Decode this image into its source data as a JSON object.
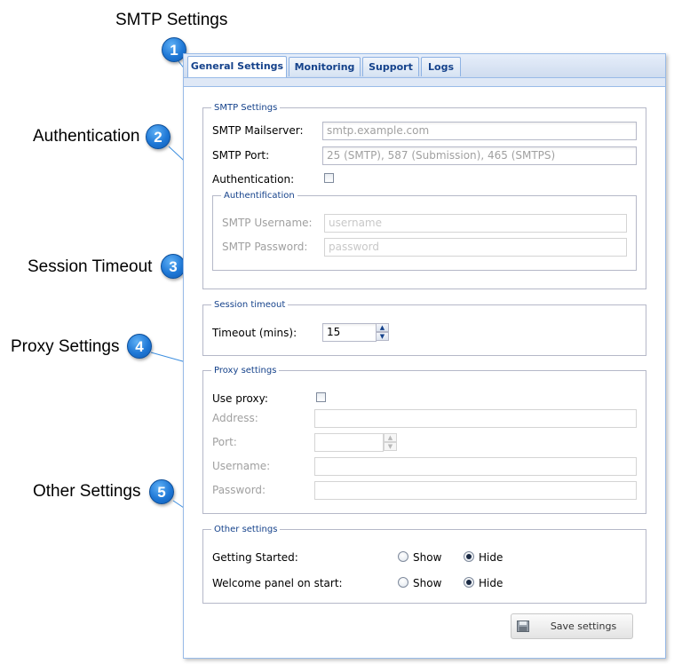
{
  "callouts": [
    {
      "num": "1",
      "label": "SMTP Settings"
    },
    {
      "num": "2",
      "label": "Authentication"
    },
    {
      "num": "3",
      "label": "Session Timeout"
    },
    {
      "num": "4",
      "label": "Proxy Settings"
    },
    {
      "num": "5",
      "label": "Other Settings"
    }
  ],
  "tabs": [
    {
      "label": "General Settings",
      "active": true
    },
    {
      "label": "Monitoring"
    },
    {
      "label": "Support"
    },
    {
      "label": "Logs"
    }
  ],
  "smtp": {
    "legend": "SMTP Settings",
    "mailserver_label": "SMTP Mailserver:",
    "mailserver_placeholder": "smtp.example.com",
    "port_label": "SMTP Port:",
    "port_placeholder": "25 (SMTP), 587 (Submission), 465 (SMTPS)",
    "auth_label": "Authentication:",
    "auth_checked": false,
    "auth": {
      "legend": "Authentification",
      "username_label": "SMTP Username:",
      "username_placeholder": "username",
      "password_label": "SMTP Password:",
      "password_placeholder": "password"
    }
  },
  "session": {
    "legend": "Session timeout",
    "timeout_label": "Timeout (mins):",
    "timeout_value": "15"
  },
  "proxy": {
    "legend": "Proxy settings",
    "use_proxy_label": "Use proxy:",
    "use_proxy_checked": false,
    "address_label": "Address:",
    "port_label": "Port:",
    "username_label": "Username:",
    "password_label": "Password:"
  },
  "other": {
    "legend": "Other settings",
    "getting_started_label": "Getting Started:",
    "welcome_label": "Welcome panel on start:",
    "show_label": "Show",
    "hide_label": "Hide",
    "getting_started_value": "Hide",
    "welcome_value": "Hide"
  },
  "save_button": {
    "label": "Save settings",
    "icon": "save-icon"
  },
  "colors": {
    "callout_badge": "#1f78d6",
    "leader_line": "#2e86de",
    "legend_text": "#15428b",
    "tab_border": "#99bbe8"
  }
}
